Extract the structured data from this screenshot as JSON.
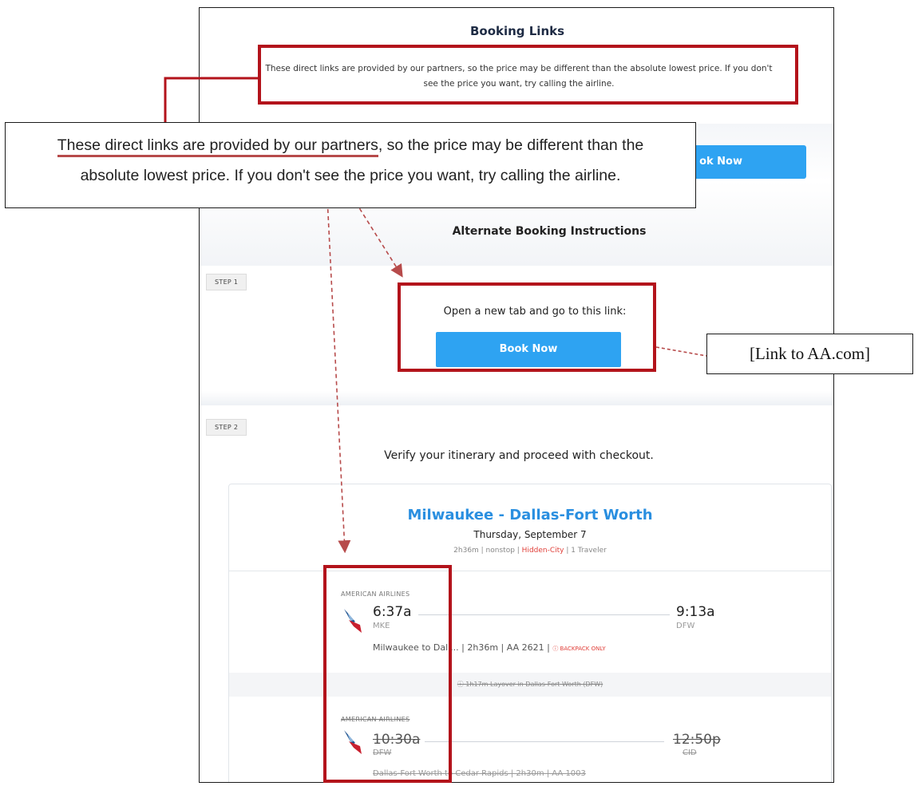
{
  "booking": {
    "title": "Booking Links",
    "notice": "These direct links are provided by our partners, so the price may be different than the absolute lowest price. If you don't see the price you want, try calling the airline.",
    "book_now_top": "ok Now",
    "alternate_title": "Alternate Booking Instructions",
    "step1_badge": "STEP 1",
    "step1_text": "Open a new tab and go to this link:",
    "book_now": "Book Now",
    "step2_badge": "STEP 2",
    "step2_text": "Verify your itinerary and proceed with checkout."
  },
  "itinerary": {
    "route": "Milwaukee - Dallas-Fort Worth",
    "date": "Thursday, September 7",
    "meta_pre": "2h36m | nonstop | ",
    "meta_hidden": "Hidden-City",
    "meta_post": " | 1 Traveler",
    "leg1": {
      "airline": "AMERICAN AIRLINES",
      "depart_time": "6:37a",
      "arrive_time": "9:13a",
      "depart_airport": "MKE",
      "arrive_airport": "DFW",
      "desc": "Milwaukee to Dall... | 2h36m | AA 2621 | ",
      "badge": "ⓘ BACKPACK ONLY"
    },
    "layover": "ⓘ   1h17m Layover in Dallas-Fort Worth (DFW)",
    "leg2": {
      "airline": "AMERICAN AIRLINES",
      "depart_time": "10:30a",
      "arrive_time": "12:50p",
      "depart_airport": "DFW",
      "arrive_airport": "CID",
      "desc": "Dallas-Fort Worth to Cedar Rapids | 2h30m | AA 1003"
    }
  },
  "annotations": {
    "callout_part1": "These direct links are provided by our partners",
    "callout_part2": ", so the price may be different than the",
    "callout_line2": "absolute lowest price. If you don't see the price you want, try calling the airline.",
    "link_label": "[Link to AA.com]"
  },
  "colors": {
    "accent_red": "#b3131b",
    "button_blue": "#2ea3f2",
    "route_blue": "#2a8fe0"
  }
}
